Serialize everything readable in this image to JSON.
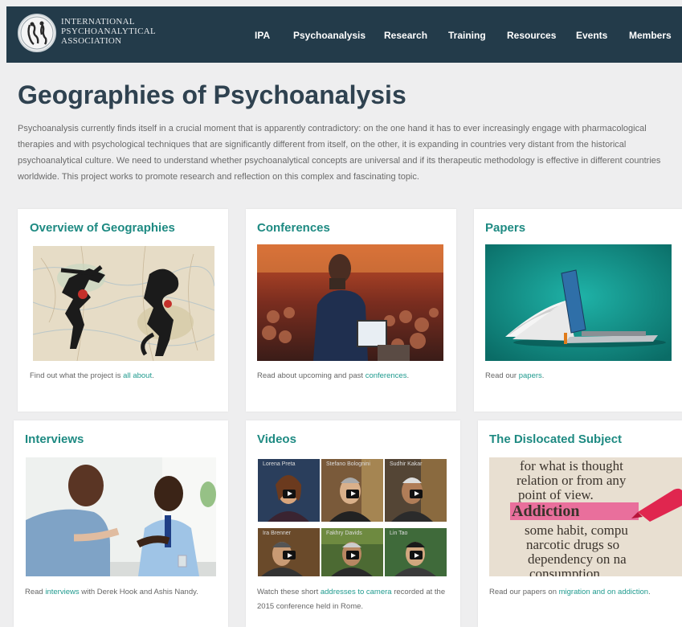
{
  "colors": {
    "header_bg": "#233b4a",
    "accent": "#1e8a82",
    "title": "#2f4250",
    "link": "#1f9a8e"
  },
  "logo": {
    "lines": [
      "INTERNATIONAL",
      "PSYCHOANALYTICAL",
      "ASSOCIATION"
    ],
    "icon": "ipa-emblem-icon"
  },
  "nav": [
    "IPA",
    "Psychoanalysis",
    "Research",
    "Training",
    "Resources",
    "Events",
    "Members"
  ],
  "page": {
    "title": "Geographies of Psychoanalysis",
    "intro": "Psychoanalysis currently finds itself in a crucial moment that is  apparently contradictory: on the one hand it has to ever increasingly engage with pharmacological therapies and with psychological techniques that are significantly different from itself, on the other, it is expanding in countries very distant from the historical psychoanalytical culture. We need to understand whether psychoanalytical concepts are universal and if its therapeutic methodology is effective in different countries worldwide. This project works to promote research and reflection on this complex and fascinating topic."
  },
  "cards": [
    {
      "title": "Overview of Geographies",
      "desc_pre": "Find out what the project is ",
      "desc_link": "all about",
      "desc_post": "."
    },
    {
      "title": "Conferences",
      "desc_pre": "Read about upcoming and past ",
      "desc_link": "conferences",
      "desc_post": "."
    },
    {
      "title": "Papers",
      "desc_pre": "Read our ",
      "desc_link": "papers",
      "desc_post": "."
    },
    {
      "title": "Interviews",
      "desc_pre": "Read ",
      "desc_link": "interviews",
      "desc_post": " with Derek Hook and Ashis Nandy."
    },
    {
      "title": "Videos",
      "desc_pre": "Watch these short ",
      "desc_link": "addresses to camera",
      "desc_post": " recorded at the 2015 conference held in Rome."
    },
    {
      "title": "The Dislocated Subject",
      "desc_pre": "Read our papers on ",
      "desc_link": "migration and on addiction",
      "desc_post": "."
    }
  ],
  "videos": [
    "Lorena Preta",
    "Stefano Bolognini",
    "Sudhir Kakar",
    "Ira Brenner",
    "Fakhry Davids",
    "Lin Tao"
  ],
  "dictionary_text": [
    "for what is thought",
    "relation or from any",
    "point of view.",
    "Addiction",
    "some habit, compu",
    "narcotic drugs so",
    "dependency on na",
    "consumption"
  ]
}
